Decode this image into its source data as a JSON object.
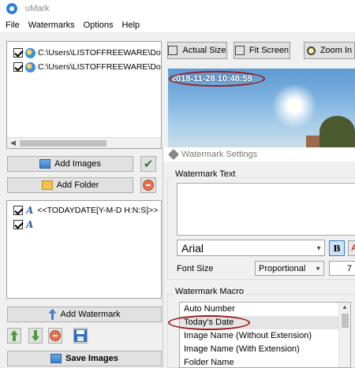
{
  "app": {
    "title": "uMark"
  },
  "menu": [
    "File",
    "Watermarks",
    "Options",
    "Help"
  ],
  "files": [
    {
      "path": "C:\\Users\\LISTOFFREEWARE\\Downlo",
      "checked": true
    },
    {
      "path": "C:\\Users\\LISTOFFREEWARE\\Downlo",
      "checked": true
    }
  ],
  "buttons": {
    "add_images": "Add Images",
    "add_folder": "Add Folder",
    "add_watermark": "Add Watermark",
    "save_images": "Save Images"
  },
  "watermarks": [
    {
      "label": "<<TODAYDATE[Y-M-D H:N:S]>>",
      "checked": true
    },
    {
      "label": "",
      "checked": true
    }
  ],
  "toolbar": {
    "actual_size": "Actual Size",
    "fit_screen": "Fit Screen",
    "zoom_in": "Zoom In"
  },
  "preview": {
    "timestamp": "2018-11-28 10:48:59"
  },
  "settings": {
    "title": "Watermark Settings",
    "text_group": "Watermark Text",
    "font": "Arial",
    "bold_label": "B",
    "italic_label": "A",
    "font_size_label": "Font Size",
    "font_size_mode": "Proportional",
    "font_size_value": "7",
    "macro_group": "Watermark Macro",
    "macros": [
      "Auto Number",
      "Today's Date",
      "Image Name (Without Extension)",
      "Image Name (With Extension)",
      "Folder Name"
    ],
    "selected_macro": "Today's Date"
  },
  "colors": {
    "highlight_oval": "#9b1c1c",
    "accent": "#3d7bd0"
  }
}
